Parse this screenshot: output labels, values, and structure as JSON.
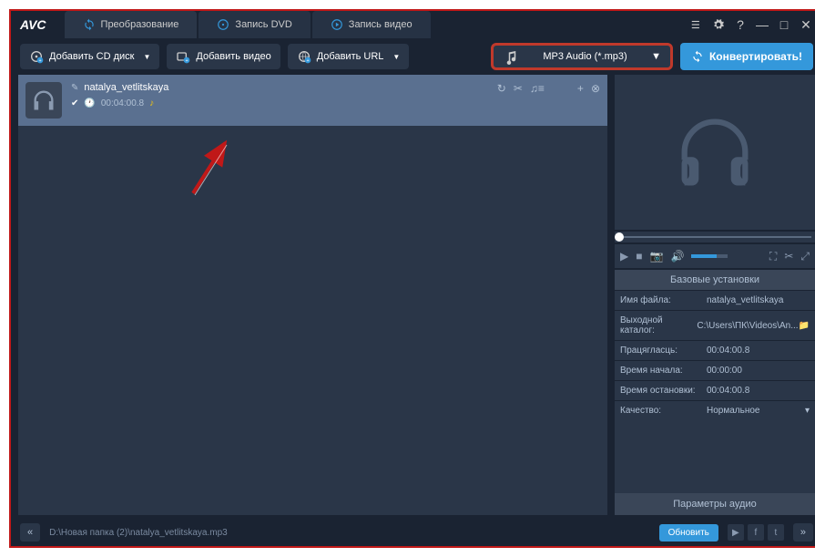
{
  "app": {
    "logo": "AVC"
  },
  "tabs": {
    "convert": "Преобразование",
    "dvd": "Запись DVD",
    "video": "Запись видео"
  },
  "toolbar": {
    "add_cd": "Добавить CD диск",
    "add_video": "Добавить видео",
    "add_url": "Добавить URL",
    "format": "MP3 Audio (*.mp3)",
    "convert": "Конвертировать!"
  },
  "file": {
    "name": "natalya_vetlitskaya",
    "duration": "00:04:00.8"
  },
  "settings": {
    "header": "Базовые установки",
    "filename_label": "Имя файла:",
    "filename_value": "natalya_vetlitskaya",
    "output_label": "Выходной каталог:",
    "output_value": "C:\\Users\\ПК\\Videos\\An...",
    "duration_label": "Працягласць:",
    "duration_value": "00:04:00.8",
    "start_label": "Время начала:",
    "start_value": "00:00:00",
    "stop_label": "Время остановки:",
    "stop_value": "00:04:00.8",
    "quality_label": "Качество:",
    "quality_value": "Нормальное",
    "audio_params": "Параметры аудио"
  },
  "status": {
    "path": "D:\\Новая папка (2)\\natalya_vetlitskaya.mp3",
    "update": "Обновить"
  }
}
